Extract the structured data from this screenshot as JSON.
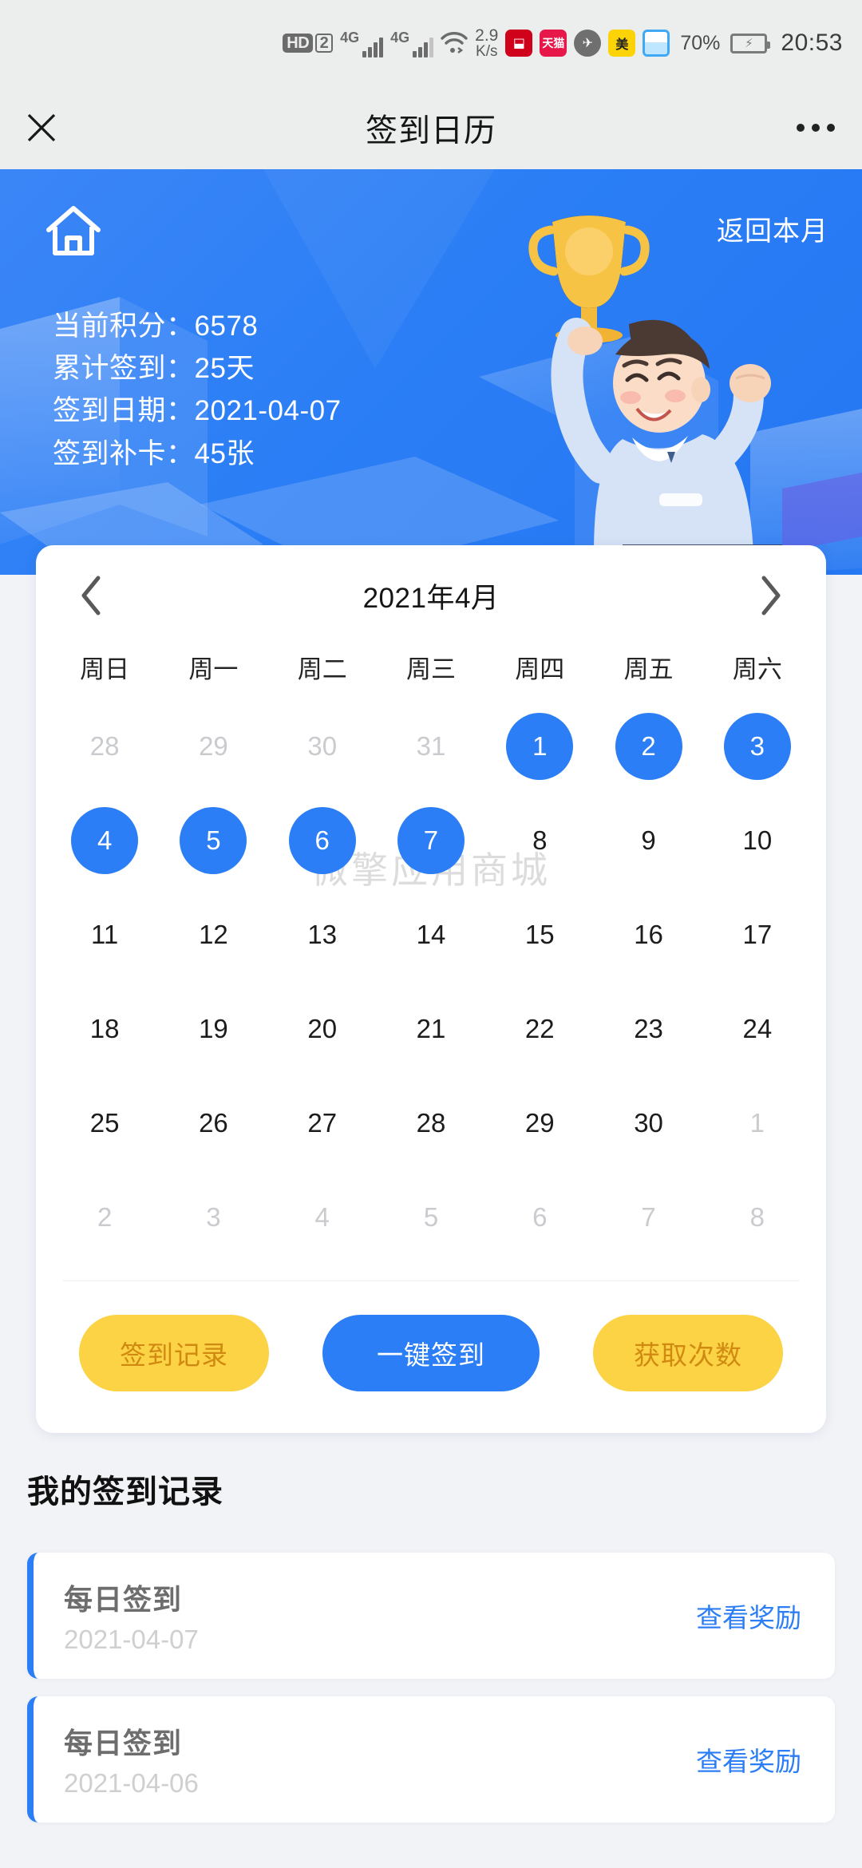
{
  "status_bar": {
    "hd_label": "HD",
    "sim_number": "2",
    "network_1": "4G",
    "network_2": "4G",
    "data_rate": "2.9",
    "data_rate_unit": "K/s",
    "app_icons": [
      "fangzheng-app-icon",
      "tmall-app-icon",
      "fliggy-app-icon",
      "meituan-app-icon",
      "mail-app-icon"
    ],
    "battery_percent": "70%",
    "time": "20:53"
  },
  "nav": {
    "close_label": "✕",
    "title": "签到日历",
    "more_label": "⋯"
  },
  "banner": {
    "home_icon": "home-icon",
    "return_month_label": "返回本月",
    "stats": [
      {
        "label": "当前积分：",
        "value": "6578"
      },
      {
        "label": "累计签到：",
        "value": "25天"
      },
      {
        "label": "签到日期：",
        "value": "2021-04-07"
      },
      {
        "label": "签到补卡：",
        "value": "45张"
      }
    ],
    "illustration": "trophy-celebration-illustration",
    "bg_color": "#2b7ef5"
  },
  "calendar": {
    "prev_label": "‹",
    "next_label": "›",
    "month_title": "2021年4月",
    "weekdays": [
      "周日",
      "周一",
      "周二",
      "周三",
      "周四",
      "周五",
      "周六"
    ],
    "watermark": "微擎应用商城",
    "checked_color": "#2b7ef5",
    "days": [
      {
        "n": "28",
        "out": true,
        "checked": false
      },
      {
        "n": "29",
        "out": true,
        "checked": false
      },
      {
        "n": "30",
        "out": true,
        "checked": false
      },
      {
        "n": "31",
        "out": true,
        "checked": false
      },
      {
        "n": "1",
        "out": false,
        "checked": true
      },
      {
        "n": "2",
        "out": false,
        "checked": true
      },
      {
        "n": "3",
        "out": false,
        "checked": true
      },
      {
        "n": "4",
        "out": false,
        "checked": true
      },
      {
        "n": "5",
        "out": false,
        "checked": true
      },
      {
        "n": "6",
        "out": false,
        "checked": true
      },
      {
        "n": "7",
        "out": false,
        "checked": true
      },
      {
        "n": "8",
        "out": false,
        "checked": false
      },
      {
        "n": "9",
        "out": false,
        "checked": false
      },
      {
        "n": "10",
        "out": false,
        "checked": false
      },
      {
        "n": "11",
        "out": false,
        "checked": false
      },
      {
        "n": "12",
        "out": false,
        "checked": false
      },
      {
        "n": "13",
        "out": false,
        "checked": false
      },
      {
        "n": "14",
        "out": false,
        "checked": false
      },
      {
        "n": "15",
        "out": false,
        "checked": false
      },
      {
        "n": "16",
        "out": false,
        "checked": false
      },
      {
        "n": "17",
        "out": false,
        "checked": false
      },
      {
        "n": "18",
        "out": false,
        "checked": false
      },
      {
        "n": "19",
        "out": false,
        "checked": false
      },
      {
        "n": "20",
        "out": false,
        "checked": false
      },
      {
        "n": "21",
        "out": false,
        "checked": false
      },
      {
        "n": "22",
        "out": false,
        "checked": false
      },
      {
        "n": "23",
        "out": false,
        "checked": false
      },
      {
        "n": "24",
        "out": false,
        "checked": false
      },
      {
        "n": "25",
        "out": false,
        "checked": false
      },
      {
        "n": "26",
        "out": false,
        "checked": false
      },
      {
        "n": "27",
        "out": false,
        "checked": false
      },
      {
        "n": "28",
        "out": false,
        "checked": false
      },
      {
        "n": "29",
        "out": false,
        "checked": false
      },
      {
        "n": "30",
        "out": false,
        "checked": false
      },
      {
        "n": "1",
        "out": true,
        "checked": false
      },
      {
        "n": "2",
        "out": true,
        "checked": false
      },
      {
        "n": "3",
        "out": true,
        "checked": false
      },
      {
        "n": "4",
        "out": true,
        "checked": false
      },
      {
        "n": "5",
        "out": true,
        "checked": false
      },
      {
        "n": "6",
        "out": true,
        "checked": false
      },
      {
        "n": "7",
        "out": true,
        "checked": false
      },
      {
        "n": "8",
        "out": true,
        "checked": false
      }
    ]
  },
  "actions": {
    "record_label": "签到记录",
    "signin_label": "一键签到",
    "times_label": "获取次数",
    "yellow_color": "#fcd344",
    "blue_color": "#2b7ef5"
  },
  "records": {
    "title": "我的签到记录",
    "items": [
      {
        "name": "每日签到",
        "date": "2021-04-07",
        "link": "查看奖励"
      },
      {
        "name": "每日签到",
        "date": "2021-04-06",
        "link": "查看奖励"
      }
    ]
  }
}
